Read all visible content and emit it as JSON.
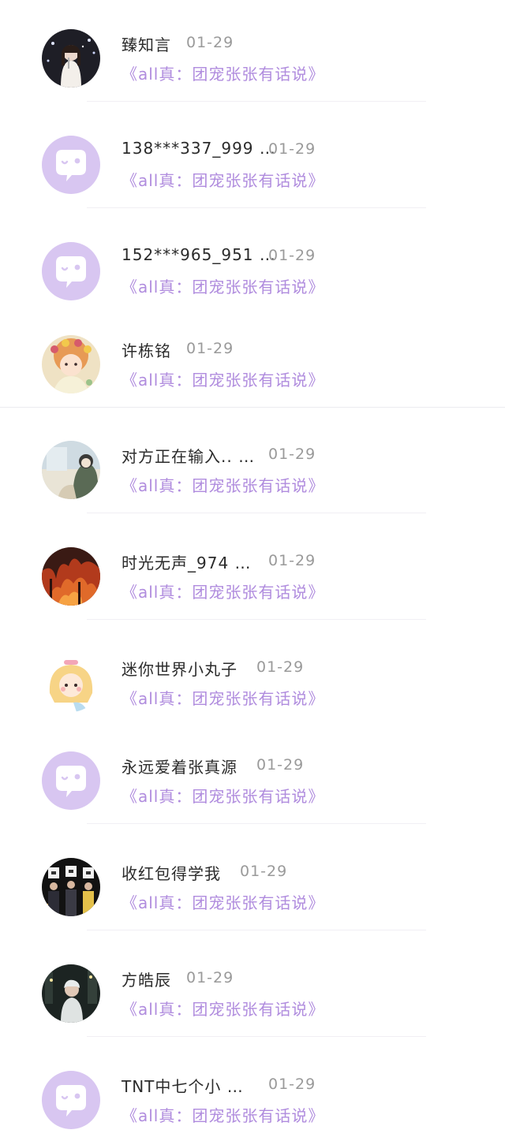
{
  "chat_list": {
    "items": [
      {
        "name": "臻知言",
        "date": "01-29",
        "preview": "《all真：团宠张张有话说》",
        "avatar": "photo-woman-avatar"
      },
      {
        "name": "138***337_999 …",
        "date": "01-29",
        "preview": "《all真：团宠张张有话说》",
        "avatar": "default-chat-bubble-icon"
      },
      {
        "name": "152***965_951 …",
        "date": "01-29",
        "preview": "《all真：团宠张张有话说》",
        "avatar": "default-chat-bubble-icon"
      },
      {
        "name": "许栋铭",
        "date": "01-29",
        "preview": "《all真：团宠张张有话说》",
        "avatar": "cartoon-girl-avatar"
      },
      {
        "name": "对方正在输入.. …",
        "date": "01-29",
        "preview": "《all真：团宠张张有话说》",
        "avatar": "illustration-avatar"
      },
      {
        "name": "时光无声_974 …",
        "date": "01-29",
        "preview": "《all真：团宠张张有话说》",
        "avatar": "photo-fire-avatar"
      },
      {
        "name": "迷你世界小丸子",
        "date": "01-29",
        "preview": "《all真：团宠张张有话说》",
        "avatar": "cartoon-girl-avatar"
      },
      {
        "name": "永远爱着张真源",
        "date": "01-29",
        "preview": "《all真：团宠张张有话说》",
        "avatar": "default-chat-bubble-icon"
      },
      {
        "name": "收红包得学我",
        "date": "01-29",
        "preview": "《all真：团宠张张有话说》",
        "avatar": "photo-group-avatar"
      },
      {
        "name": "方皓辰",
        "date": "01-29",
        "preview": "《all真：团宠张张有话说》",
        "avatar": "photo-street-avatar"
      },
      {
        "name": "TNT中七个小 …",
        "date": "01-29",
        "preview": "《all真：团宠张张有话说》",
        "avatar": "default-chat-bubble-icon"
      }
    ]
  },
  "colors": {
    "accent_purple": "#b08cde",
    "default_avatar_bg": "#d8c6f1",
    "name_text": "#2b2b2b",
    "date_text": "#9a9a9a"
  }
}
